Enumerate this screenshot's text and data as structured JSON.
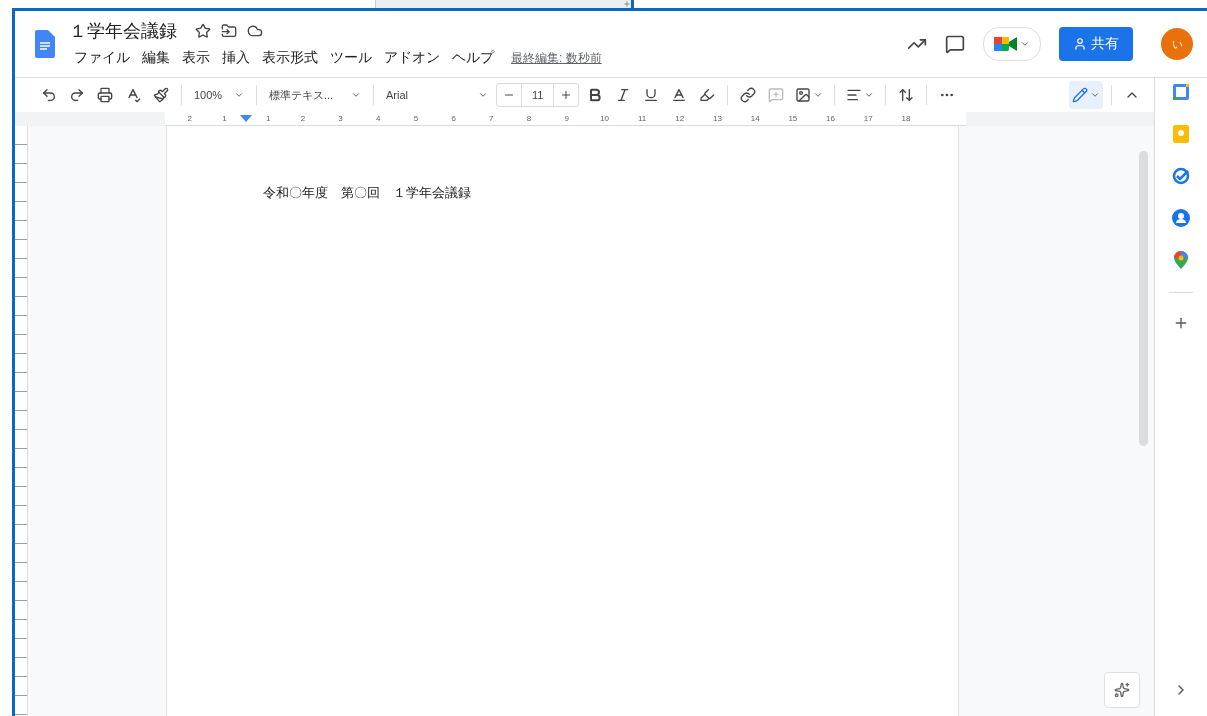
{
  "document": {
    "title": "１学年会議録",
    "last_edit": "最終編集: 数秒前"
  },
  "menu": [
    "ファイル",
    "編集",
    "表示",
    "挿入",
    "表示形式",
    "ツール",
    "アドオン",
    "ヘルプ"
  ],
  "share_button": "共有",
  "avatar": "い",
  "toolbar": {
    "zoom": "100%",
    "style": "標準テキス...",
    "font": "Arial",
    "font_size": "11"
  },
  "ruler": [
    "2",
    "1",
    "1",
    "2",
    "3",
    "4",
    "5",
    "6",
    "7",
    "8",
    "9",
    "10",
    "11",
    "12",
    "13",
    "14",
    "15",
    "16",
    "17",
    "18"
  ],
  "body": [
    "令和〇年度　第〇回　１学年会議録"
  ]
}
